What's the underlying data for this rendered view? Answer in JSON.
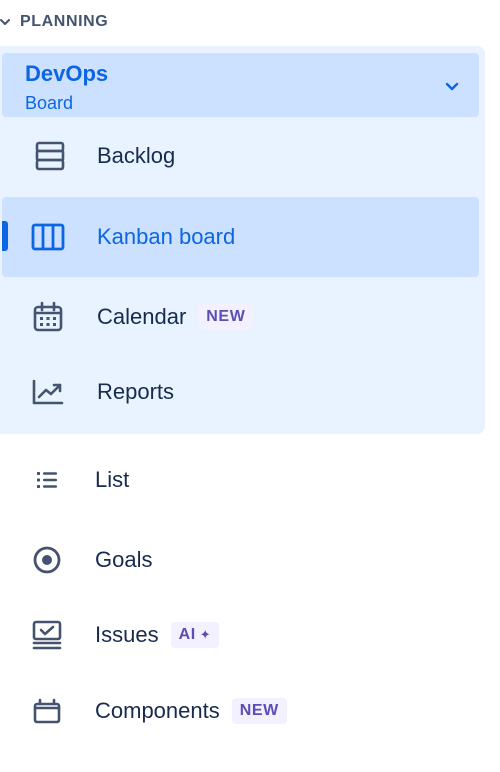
{
  "section": {
    "label": "PLANNING"
  },
  "group": {
    "title": "DevOps",
    "subtitle": "Board",
    "items": [
      {
        "label": "Backlog"
      },
      {
        "label": "Kanban board"
      },
      {
        "label": "Calendar",
        "badge": "NEW"
      },
      {
        "label": "Reports"
      }
    ]
  },
  "nav": {
    "items": [
      {
        "label": "List"
      },
      {
        "label": "Goals"
      },
      {
        "label": "Issues",
        "badge": "AI"
      },
      {
        "label": "Components",
        "badge": "NEW"
      }
    ]
  },
  "colors": {
    "accent": "#0c66e4",
    "selected_bg": "#cce0ff",
    "group_bg": "#e9f2ff",
    "text": "#172b4d",
    "badge_bg": "#f3f0ff",
    "badge_text": "#5e4db2"
  }
}
